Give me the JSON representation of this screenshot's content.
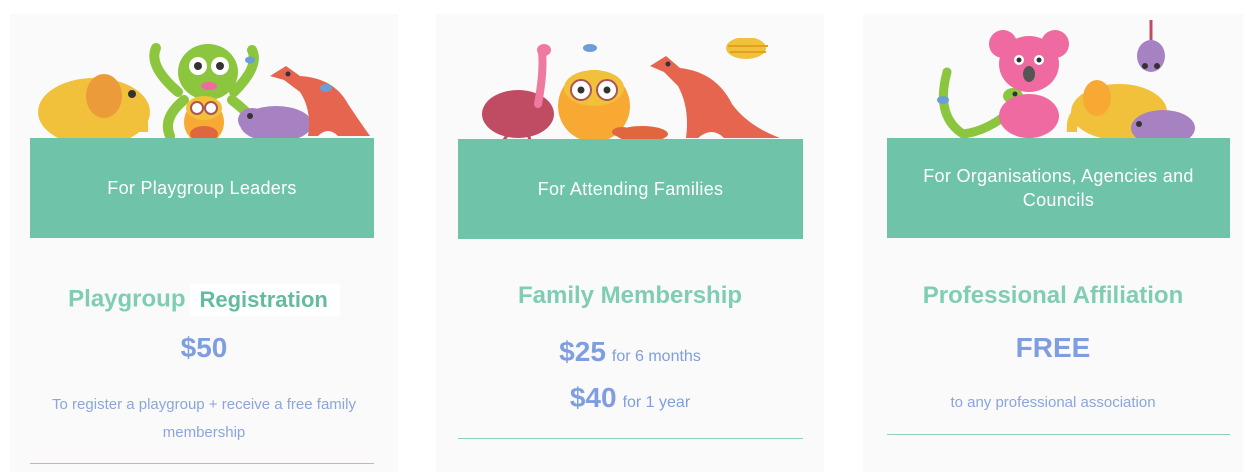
{
  "cards": [
    {
      "banner": "For Playgroup Leaders",
      "title": "Playgroup",
      "title_highlight": "Registration",
      "price": "$50",
      "description": "To register a playgroup + receive a free family membership",
      "animal_icons": [
        "elephant-icon",
        "octopus-icon",
        "owl-icon",
        "wombat-icon",
        "kangaroo-icon",
        "bird-icon"
      ]
    },
    {
      "banner": "For Attending Families",
      "title": "Family Membership",
      "prices": [
        {
          "amount": "$25",
          "period": "for 6 months"
        },
        {
          "amount": "$40",
          "period": "for 1 year"
        }
      ],
      "animal_icons": [
        "emu-icon",
        "owl-icon",
        "platypus-icon",
        "kangaroo-icon",
        "echidna-icon",
        "bird-icon"
      ]
    },
    {
      "banner": "For Organisations, Agencies and Councils",
      "title": "Professional Affiliation",
      "price": "FREE",
      "description": "to any professional association",
      "animal_icons": [
        "koala-icon",
        "lizard-icon",
        "elephant-icon",
        "possum-icon",
        "wombat-icon",
        "bird-icon"
      ]
    }
  ],
  "colors": {
    "banner": "#6fc3a9",
    "title": "#7fcdb4",
    "price": "#7e9ee0",
    "description": "#8aa6dc",
    "card_background": "#fafafb"
  }
}
